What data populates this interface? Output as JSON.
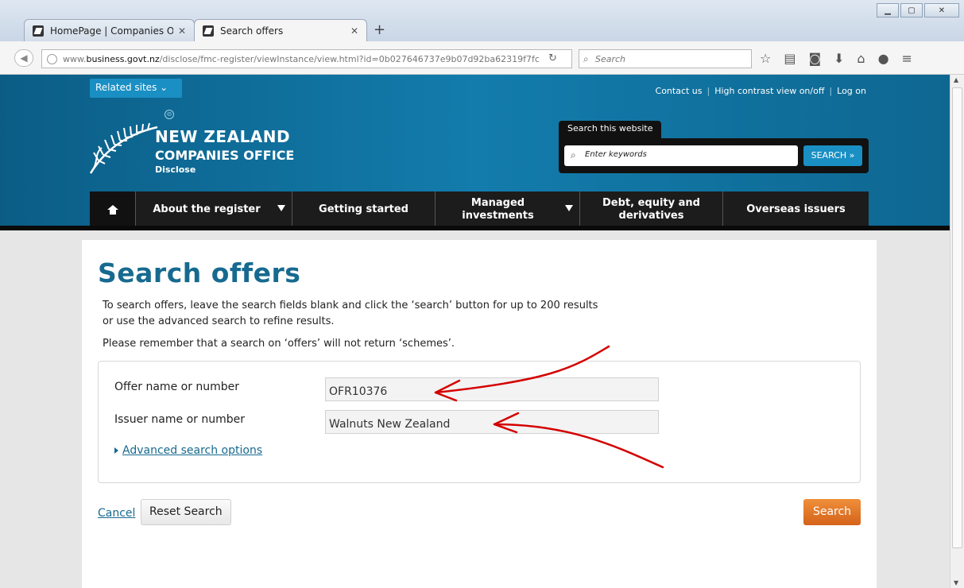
{
  "browser": {
    "tabs": [
      {
        "label": "HomePage | Companies O...",
        "active": false
      },
      {
        "label": "Search offers",
        "active": true
      }
    ],
    "url_prefix": "www.",
    "url_domain": "business.govt.nz",
    "url_path": "/disclose/fmc-register/viewInstance/view.html?id=0b027646737e9b07d92ba62319f7fc",
    "search_placeholder": "Search"
  },
  "header": {
    "related_sites": "Related sites ⌄",
    "top_links": [
      "Contact us",
      "High contrast view on/off",
      "Log on"
    ],
    "logo_line1": "NEW ZEALAND",
    "logo_line2": "COMPANIES OFFICE",
    "logo_line3": "Disclose",
    "search_tab": "Search this website",
    "search_placeholder": "Enter keywords",
    "search_button": "SEARCH »"
  },
  "nav": {
    "items": [
      {
        "label": "About the register",
        "dropdown": true
      },
      {
        "label": "Getting started",
        "dropdown": false
      },
      {
        "label": "Managed investments",
        "dropdown": true
      },
      {
        "label": "Debt, equity and derivatives",
        "dropdown": false
      },
      {
        "label": "Overseas issuers",
        "dropdown": false
      }
    ]
  },
  "main": {
    "title": "Search offers",
    "intro": "To search offers, leave the search fields blank and click the ‘search’ button for up to 200 results or use the advanced search to refine results.",
    "note": "Please remember that a search on ‘offers’ will not return ‘schemes’.",
    "fields": [
      {
        "label": "Offer name or number",
        "value": "OFR10376"
      },
      {
        "label": "Issuer name or number",
        "value": "Walnuts New Zealand"
      }
    ],
    "advanced_link": "Advanced search options",
    "cancel": "Cancel",
    "reset": "Reset Search",
    "search": "Search"
  },
  "colors": {
    "brand_blue": "#176a8f",
    "header_blue": "#137cac",
    "search_orange": "#e07a2a",
    "annotation_red": "#d40000"
  }
}
